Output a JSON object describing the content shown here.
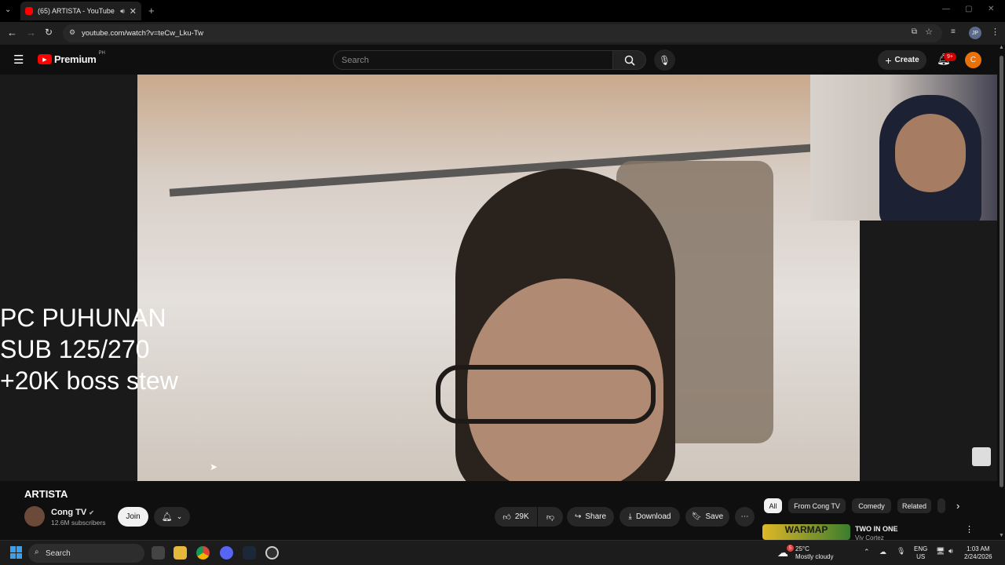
{
  "browser": {
    "tab_title": "(65) ARTISTA - YouTube",
    "url": "youtube.com/watch?v=teCw_Lku-Tw",
    "profile_initials": "JP"
  },
  "yt_header": {
    "brand": "Premium",
    "region": "PH",
    "search_placeholder": "Search",
    "create_label": "Create",
    "notif_count": "9+",
    "avatar_letter": "C"
  },
  "video": {
    "overlay_text": "PC PUHUNAN\nSUB 125/270\n+20K boss stew"
  },
  "details": {
    "title": "ARTISTA",
    "channel": "Cong TV",
    "subscribers": "12.6M subscribers",
    "join_label": "Join",
    "likes": "29K",
    "share_label": "Share",
    "download_label": "Download",
    "save_label": "Save"
  },
  "chips": [
    "All",
    "From Cong TV",
    "Comedy",
    "Related"
  ],
  "suggestion": {
    "thumb_text": "WARMAP",
    "title": "TWO IN ONE",
    "channel": "Viy Cortez"
  },
  "taskbar": {
    "search_label": "Search",
    "temp": "25°C",
    "weather": "Mostly cloudy",
    "lang": "ENG",
    "region": "US",
    "time": "1:03 AM",
    "date": "2/24/2026",
    "weather_badge": "5"
  },
  "colors": {
    "yt_red": "#ff0000",
    "background": "#0f0f0f",
    "chip_active": "#f1f1f1"
  }
}
